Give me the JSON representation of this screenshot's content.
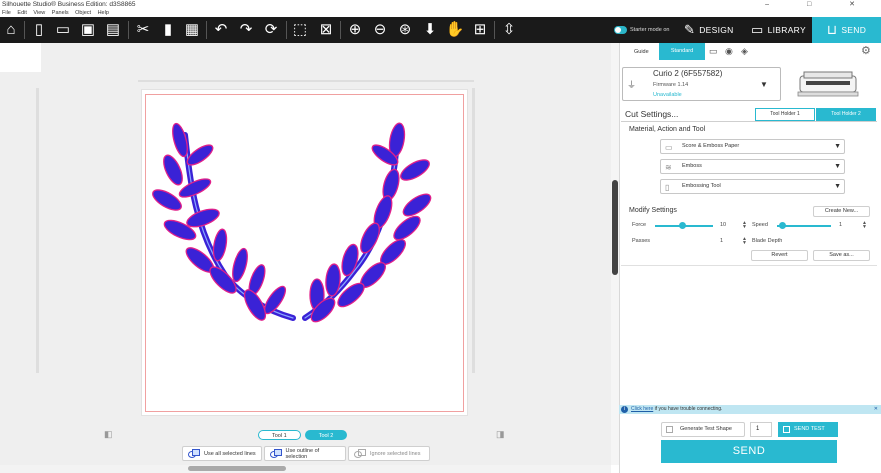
{
  "window": {
    "title": "Silhouette Studio® Business Edition: d3S8865",
    "controls": [
      "–",
      "□",
      "✕"
    ]
  },
  "menu": [
    "File",
    "Edit",
    "View",
    "Panels",
    "Object",
    "Help"
  ],
  "toolbar": {
    "icons": [
      "home-icon",
      "new-icon",
      "open-icon",
      "save-icon",
      "print-icon",
      "cut-icon",
      "copy-icon",
      "paste-icon",
      "undo-icon",
      "redo-icon",
      "redraw-icon",
      "select-icon",
      "deselect-icon",
      "zoom-in-icon",
      "zoom-out-icon",
      "zoom-fit-icon",
      "move-down-icon",
      "pan-icon",
      "add-page-icon",
      "fit-page-icon"
    ],
    "starter_mode_label": "Starter mode on",
    "tab_design": "DESIGN",
    "tab_library": "LIBRARY",
    "tab_send": "SEND"
  },
  "canvas": {
    "tool_tabs": [
      "Tool 1",
      "Tool 2"
    ],
    "active_tool_tab": "Tool 2",
    "line_options": [
      "Use all selected lines",
      "Use outline of selection",
      "Ignore selected lines"
    ],
    "shape_colors": {
      "fill": "#3a22d6",
      "outline": "#e0208a",
      "accent": "#8aa8ff"
    }
  },
  "send_panel": {
    "tab_guide": "Guide",
    "tab_standard": "Standard",
    "device_name": "Curio 2 (6F557582)",
    "firmware": "Firmware 1.14",
    "device_status": "Unavailable",
    "cut_settings_title": "Cut Settings...",
    "tool_holder_1": "Tool Holder 1",
    "tool_holder_2": "Tool Holder 2",
    "material_title": "Material, Action and Tool",
    "material": "Score & Emboss Paper",
    "action": "Emboss",
    "tool": "Embossing Tool",
    "modify_title": "Modify Settings",
    "create_new": "Create New...",
    "force_label": "Force",
    "force_value": "10",
    "speed_label": "Speed",
    "speed_value": "1",
    "passes_label": "Passes",
    "passes_value": "1",
    "blade_depth_label": "Blade Depth",
    "revert": "Revert",
    "save_as": "Save as...",
    "help_link": "Click here",
    "help_text": " if you have trouble connecting.",
    "help_close": "✕",
    "generate_test": "Generate Test Shape",
    "test_count": "1",
    "send_test": "SEND TEST",
    "send": "SEND"
  },
  "colors": {
    "accent": "#29b9d0",
    "toolbar": "#1a1a1a"
  }
}
